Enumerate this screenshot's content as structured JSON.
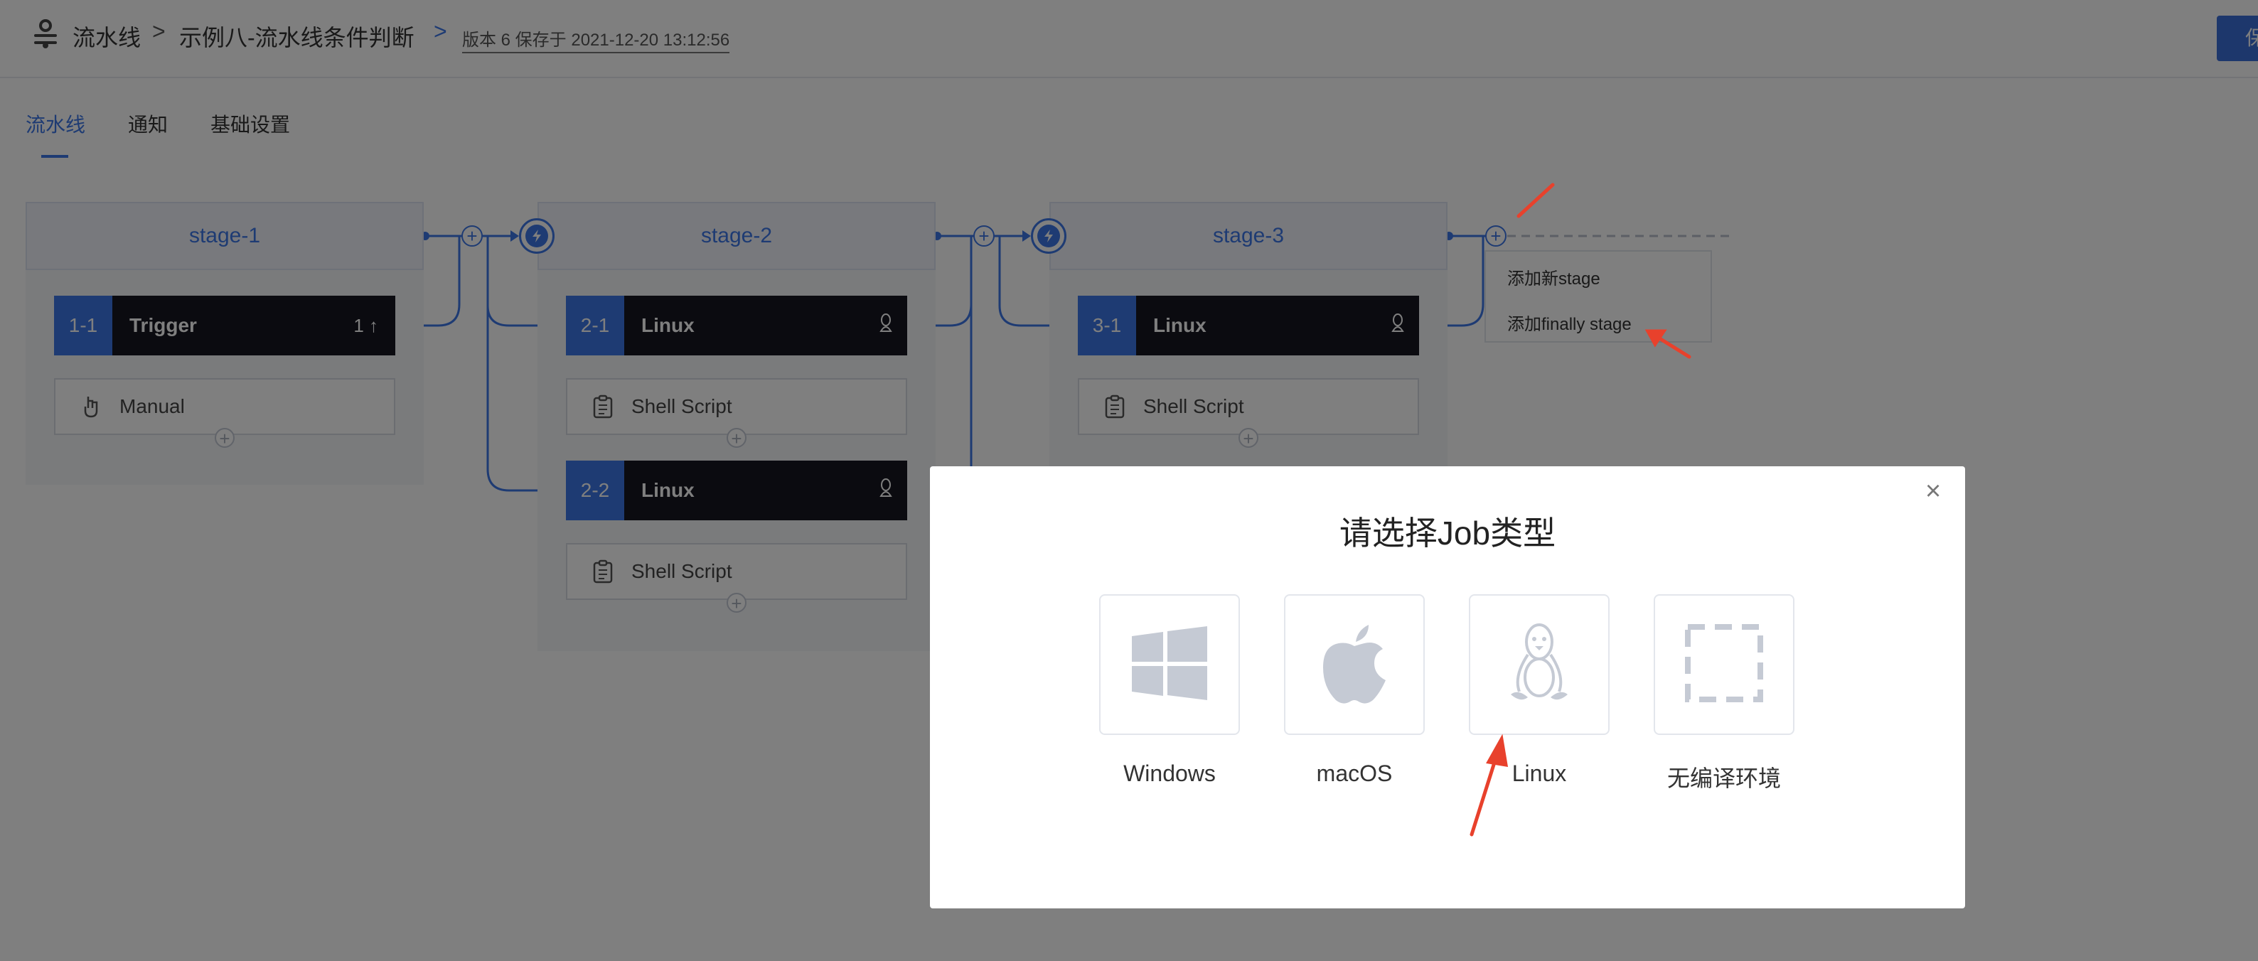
{
  "header": {
    "breadcrumb_root": "流水线",
    "breadcrumb_sep": ">",
    "pipeline_name": "示例八-流水线条件判断",
    "version_info": "版本 6 保存于 2021-12-20 13:12:56",
    "save_label": "保"
  },
  "tabs": [
    {
      "label": "流水线",
      "active": true
    },
    {
      "label": "通知",
      "active": false
    },
    {
      "label": "基础设置",
      "active": false
    }
  ],
  "stages": [
    {
      "name": "stage-1",
      "jobs": [
        {
          "id": "1-1",
          "name": "Trigger",
          "badge": "1 ↑",
          "tasks": [
            {
              "name": "Manual",
              "icon": "hand-pointer-icon"
            }
          ]
        }
      ]
    },
    {
      "name": "stage-2",
      "jobs": [
        {
          "id": "2-1",
          "name": "Linux",
          "os_icon": "linux-icon",
          "tasks": [
            {
              "name": "Shell Script",
              "icon": "clipboard-icon"
            }
          ]
        },
        {
          "id": "2-2",
          "name": "Linux",
          "os_icon": "linux-icon",
          "tasks": [
            {
              "name": "Shell Script",
              "icon": "clipboard-icon"
            }
          ]
        }
      ]
    },
    {
      "name": "stage-3",
      "jobs": [
        {
          "id": "3-1",
          "name": "Linux",
          "os_icon": "linux-icon",
          "tasks": [
            {
              "name": "Shell Script",
              "icon": "clipboard-icon"
            }
          ]
        }
      ]
    }
  ],
  "add_stage_menu": {
    "items": [
      "添加新stage",
      "添加finally stage"
    ]
  },
  "modal": {
    "title": "请选择Job类型",
    "close": "×",
    "options": [
      {
        "label": "Windows",
        "icon": "windows-icon"
      },
      {
        "label": "macOS",
        "icon": "apple-icon"
      },
      {
        "label": "Linux",
        "icon": "linux-icon"
      },
      {
        "label": "无编译环境",
        "icon": "no-env-icon"
      }
    ]
  },
  "colors": {
    "accent": "#3c76e6",
    "job_header": "#161620",
    "annotation_arrow": "#e8412c",
    "overlay": "rgba(0,0,0,0.5)"
  }
}
